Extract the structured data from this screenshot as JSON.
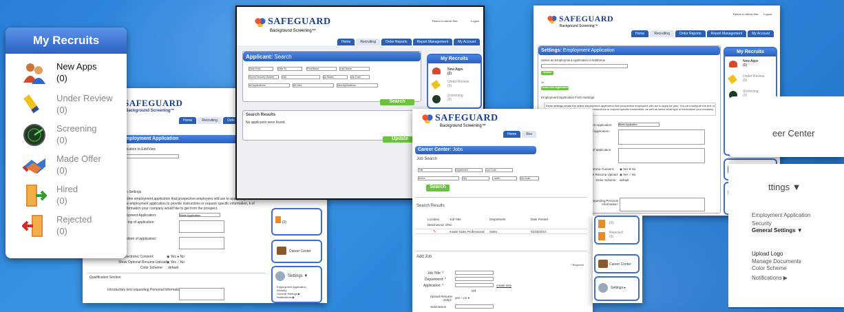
{
  "brand": {
    "name": "SAFEGUARD",
    "tagline": "Background Screening™"
  },
  "nav": {
    "home": "Home",
    "recruiting": "Recruiting",
    "order_reports": "Order Reports",
    "report_mgmt": "Report Management",
    "my_account": "My Account"
  },
  "top_links": {
    "admin": "Return to Admin Site",
    "logout": "Logout"
  },
  "recruits": {
    "title": "My Recruits",
    "items": [
      {
        "label": "New Apps",
        "count": "(0)"
      },
      {
        "label": "Under Review",
        "count": "(0)"
      },
      {
        "label": "Screening",
        "count": "(0)"
      },
      {
        "label": "Made Offer",
        "count": "(0)"
      },
      {
        "label": "Hired",
        "count": "(0)"
      },
      {
        "label": "Rejected",
        "count": "(0)"
      }
    ]
  },
  "applicant": {
    "title": "Applicant:",
    "subtitle": "Search",
    "date_from": "Date From",
    "date_to": "Date To",
    "first_name": "First Name",
    "last_name": "Last Name",
    "ssn": "Social Security Number",
    "city": "City",
    "all_states": "All States",
    "zip": "Zip Code",
    "all_applications": "All Applications",
    "all_jobs": "All Jobs",
    "new_applications": "New Applications",
    "search": "Search",
    "results_title": "Search Results",
    "no_results": "No applicants were found.",
    "update": "Update"
  },
  "settings": {
    "title": "Settings:",
    "subtitle": "Employment Application",
    "select_label": "Select an Employment Application to Edit/View",
    "submit": "Submit",
    "or": "Or",
    "create": "Create New Application",
    "form_settings": "Employment Application Form Settings",
    "desc": "These settings create the online employment application that prospective employees will use to apply for jobs. You can configure the text of the employment application to provide instructions or request specific information, as well as select what type of information your company would like to get from the prospect.",
    "title_label": "Title for Employment Application:",
    "title_value": "Blank Application",
    "intro_label": "Introductory text at top of application:",
    "closing_label": "Closing text at bottom of application:",
    "capture_label": "Capture Electronic Consent:",
    "resume_label": "Show Optional Resume Upload:",
    "yes": "Yes",
    "no": "No",
    "color_label": "Color Scheme:",
    "color_value": "default",
    "qual_section": "Qualification Section",
    "intro_personal": "Introductory text requesting Personal Information:"
  },
  "career": {
    "title": "Career Center:",
    "subtitle": "Jobs",
    "job_search": "Job Search",
    "f_title": "Title",
    "f_dept": "Department",
    "f_job_code": "Job Code",
    "f_active": "Active",
    "f_city": "City",
    "f_state": "--state--",
    "f_zip": "Zip Code",
    "search": "Search",
    "results": "Search Results",
    "col_location": "Location",
    "col_title": "Job Title",
    "col_dept": "Department",
    "col_date": "Date Posted",
    "row_location": "Beachwood, Ohio",
    "row_title": "Inside Sales Professional",
    "row_dept": "Sales",
    "row_date": "01/15/2010",
    "add_job": "Add Job",
    "required": "* Required",
    "job_title": "Job Title: *",
    "department": "Department: *",
    "application": "Application: *",
    "create_new": "create new",
    "off": "Off",
    "upload_resume": "Upload Resume Only?:",
    "submission": "Submission"
  },
  "side": {
    "career_center": "Career Center",
    "settings": "Settings ▼",
    "settings_short": "Settings ▸",
    "s_items": [
      "Employment Application",
      "Security",
      "General Settings ▶",
      "Notifications ▶"
    ]
  },
  "right_card": {
    "career_center": "eer Center",
    "settings": "ttings ▼",
    "emp_app": "Employment Application",
    "security": "Security",
    "general": "General Settings ▼",
    "upload_logo": "Upload Logo",
    "manage_docs": "Manage Documents",
    "color_scheme": "Color Scheme",
    "notifications": "Notifications ▶"
  },
  "colors": {
    "accent": "#2a5fbf",
    "green": "#6bc23e",
    "brand": "#1d3f8f"
  }
}
